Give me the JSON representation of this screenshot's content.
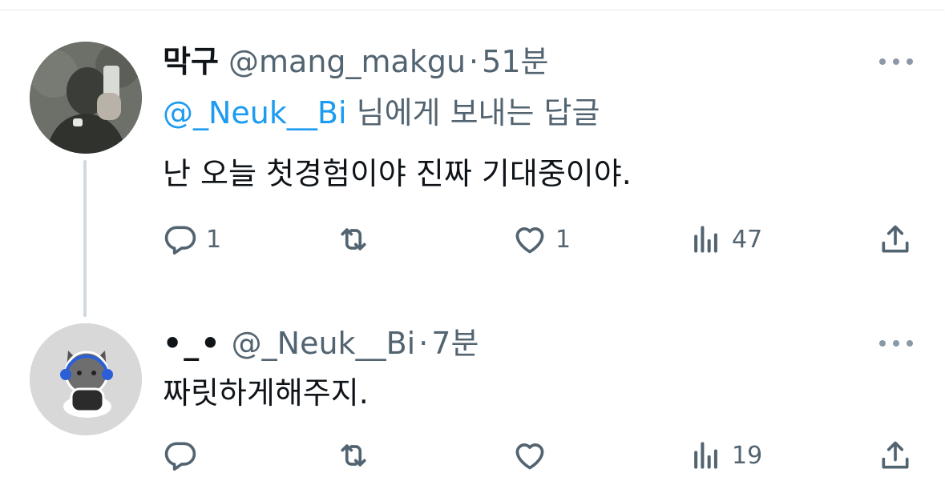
{
  "tweets": [
    {
      "author_name": "막구",
      "handle": "@mang_makgu",
      "separator": "·",
      "time": "51분",
      "reply_mention": "@_Neuk__Bi",
      "reply_suffix": "님에게 보내는 답글",
      "text": "난 오늘 첫경험이야 진짜 기대중이야.",
      "counts": {
        "reply": "1",
        "retweet": "",
        "like": "1",
        "views": "47"
      }
    },
    {
      "author_name": "•_•",
      "handle": "@_Neuk__Bi",
      "separator": "·",
      "time": "7분",
      "text": "짜릿하게해주지.",
      "counts": {
        "reply": "",
        "retweet": "",
        "like": "",
        "views": "19"
      }
    }
  ],
  "icons": [
    "more-icon",
    "reply-icon",
    "retweet-icon",
    "like-icon",
    "views-icon",
    "share-icon"
  ],
  "colors": {
    "text": "#0f1419",
    "secondary": "#536471",
    "link": "#1d9bf0",
    "thread_line": "#cfd9de"
  }
}
